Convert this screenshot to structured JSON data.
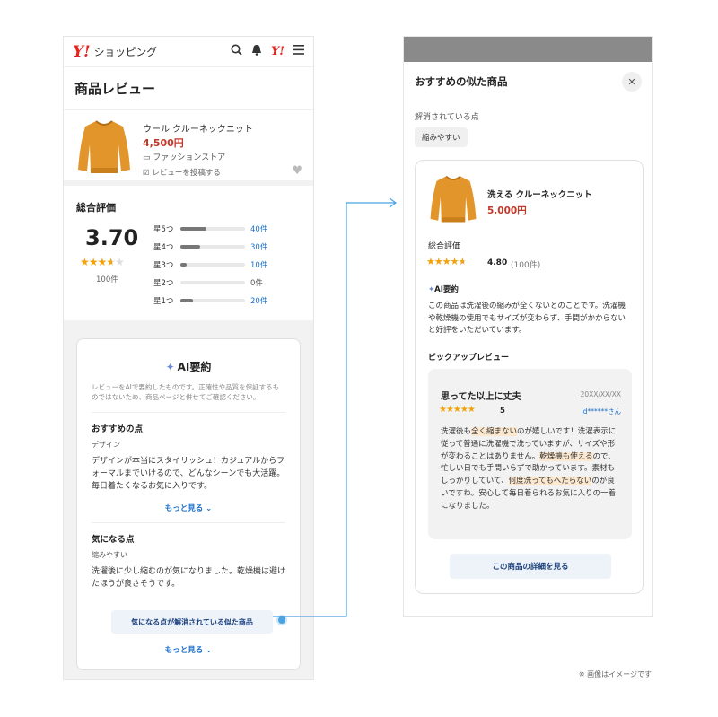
{
  "colors": {
    "brand_red": "#e8231e",
    "star": "#f2a20a",
    "link": "#1a6fc9",
    "price": "#c0392b"
  },
  "left": {
    "header": {
      "logo": "Y!",
      "logo_text": "ショッピング",
      "icons": [
        "search-icon",
        "bell-icon",
        "yahoo-icon",
        "menu-icon"
      ],
      "yahoo_label": "Y!"
    },
    "page_title": "商品レビュー",
    "product": {
      "name": "ウール クルーネックニット",
      "price": "4,500円",
      "store": "ファッションストア",
      "post_review": "レビューを投稿する"
    },
    "rating": {
      "title": "総合評価",
      "score": "3.70",
      "stars": 3.7,
      "count": "100件",
      "distribution": [
        {
          "label": "星5つ",
          "fraction": 0.4,
          "count": "40件"
        },
        {
          "label": "星4つ",
          "fraction": 0.3,
          "count": "30件"
        },
        {
          "label": "星3つ",
          "fraction": 0.1,
          "count": "10件"
        },
        {
          "label": "星2つ",
          "fraction": 0.0,
          "count": "0件"
        },
        {
          "label": "星1つ",
          "fraction": 0.2,
          "count": "20件"
        }
      ]
    },
    "ai": {
      "title": "AI要約",
      "note": "レビューをAIで要約したものです。正確性や品質を保証するものではないため、商品ページと併せてご確認ください。",
      "good": {
        "title": "おすすめの点",
        "sub": "デザイン",
        "body": "デザインが本当にスタイリッシュ！カジュアルからフォーマルまでいけるので、どんなシーンでも大活躍。毎日着たくなるお気に入りです。",
        "more": "もっと見る ⌄"
      },
      "bad": {
        "title": "気になる点",
        "sub": "縮みやすい",
        "body": "洗濯後に少し縮むのが気になりました。乾燥機は避けたほうが良さそうです。",
        "more": "もっと見る ⌄"
      },
      "similar_button": "気になる点が解消されている似た商品"
    }
  },
  "right": {
    "modal_title": "おすすめの似た商品",
    "resolved_label": "解消されている点",
    "chip": "縮みやすい",
    "product": {
      "name": "洗える クルーネックニット",
      "price": "5,000円"
    },
    "rating": {
      "title": "総合評価",
      "score": "4.80",
      "count": "(100件)",
      "stars": 4.8
    },
    "ai": {
      "title": "AI要約",
      "body": "この商品は洗濯後の縮みが全くないとのことです。洗濯機や乾燥機の使用でもサイズが変わらず、手間がかからないと好評をいただいています。"
    },
    "pickup_title": "ピックアップレビュー",
    "review": {
      "title": "思ってた以上に丈夫",
      "date": "20XX/XX/XX",
      "stars": 5,
      "score": "5",
      "user": "id******さん",
      "body_parts": [
        {
          "t": "洗濯後も",
          "h": false
        },
        {
          "t": "全く縮まない",
          "h": true
        },
        {
          "t": "のが嬉しいです！洗濯表示に従って普通に洗濯機で洗っていますが、サイズや形が変わることはありません。",
          "h": false
        },
        {
          "t": "乾燥機も使える",
          "h": true
        },
        {
          "t": "ので、忙しい日でも手間いらずで助かっています。素材もしっかりしていて、",
          "h": false
        },
        {
          "t": "何度洗ってもへたらない",
          "h": true
        },
        {
          "t": "のが良いですね。安心して毎日着られるお気に入りの一着になりました。",
          "h": false
        }
      ]
    },
    "detail_button": "この商品の詳細を見る"
  },
  "footnote": "※ 画像はイメージです"
}
